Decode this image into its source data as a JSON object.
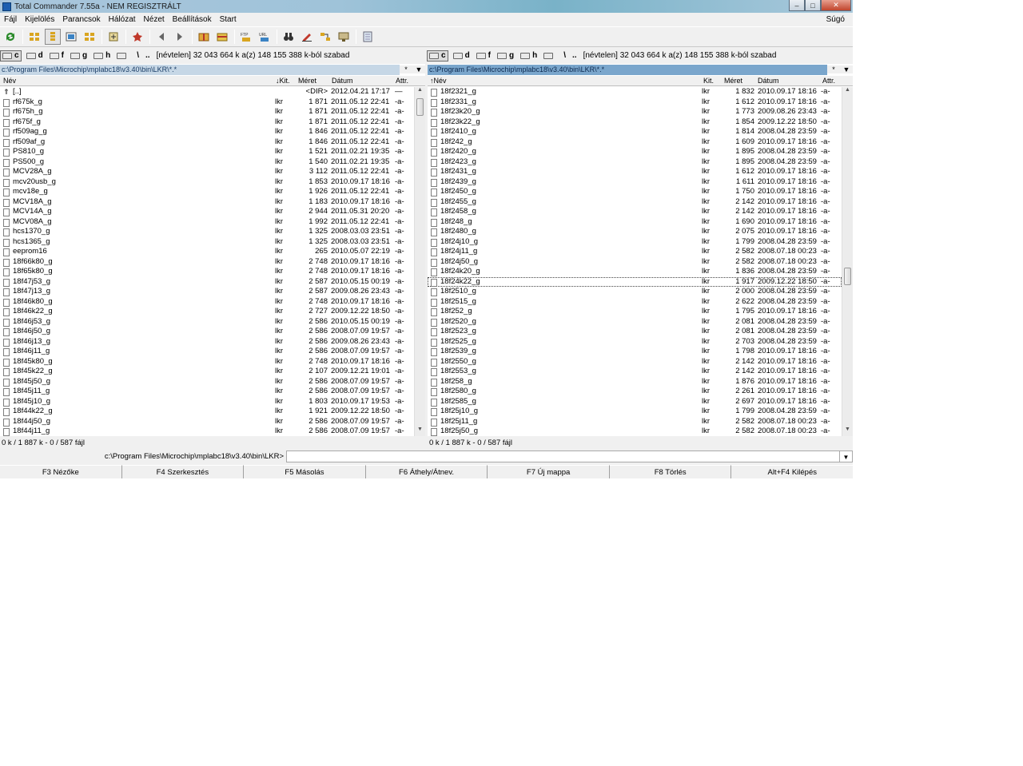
{
  "window": {
    "title": "Total Commander 7.55a - NEM REGISZTRÁLT",
    "min": "–",
    "max": "□",
    "close": "✕"
  },
  "menu": [
    "Fájl",
    "Kijelölés",
    "Parancsok",
    "Hálózat",
    "Nézet",
    "Beállítások",
    "Start"
  ],
  "menu_help": "Súgó",
  "drives": {
    "items": [
      {
        "label": "c",
        "active": true
      },
      {
        "label": "d"
      },
      {
        "label": "f"
      },
      {
        "label": "g"
      },
      {
        "label": "h"
      }
    ],
    "root": "\\",
    "up": "..",
    "info": "[névtelen]  32 043 664 k a(z) 148 155 388 k-ból szabad"
  },
  "left_panel": {
    "path": "c:\\Program Files\\Microchip\\mplabc18\\v3.40\\bin\\LKR\\*.*",
    "star": "*",
    "hist": "▼",
    "columns": {
      "name": "Név",
      "ext": "↓Kit.",
      "size": "Méret",
      "date": "Dátum",
      "attr": "Attr."
    },
    "status": "0 k / 1 887 k - 0 / 587 fájl",
    "rows": [
      {
        "name": "[..]",
        "ext": "",
        "size": "<DIR>",
        "date": "2012.04.21 17:17",
        "attr": "—"
      },
      {
        "name": "rf675k_g",
        "ext": "lkr",
        "size": "1 871",
        "date": "2011.05.12 22:41",
        "attr": "-a-"
      },
      {
        "name": "rf675h_g",
        "ext": "lkr",
        "size": "1 871",
        "date": "2011.05.12 22:41",
        "attr": "-a-"
      },
      {
        "name": "rf675f_g",
        "ext": "lkr",
        "size": "1 871",
        "date": "2011.05.12 22:41",
        "attr": "-a-"
      },
      {
        "name": "rf509ag_g",
        "ext": "lkr",
        "size": "1 846",
        "date": "2011.05.12 22:41",
        "attr": "-a-"
      },
      {
        "name": "rf509af_g",
        "ext": "lkr",
        "size": "1 846",
        "date": "2011.05.12 22:41",
        "attr": "-a-"
      },
      {
        "name": "PS810_g",
        "ext": "lkr",
        "size": "1 521",
        "date": "2011.02.21 19:35",
        "attr": "-a-"
      },
      {
        "name": "PS500_g",
        "ext": "lkr",
        "size": "1 540",
        "date": "2011.02.21 19:35",
        "attr": "-a-"
      },
      {
        "name": "MCV28A_g",
        "ext": "lkr",
        "size": "3 112",
        "date": "2011.05.12 22:41",
        "attr": "-a-"
      },
      {
        "name": "mcv20usb_g",
        "ext": "lkr",
        "size": "1 853",
        "date": "2010.09.17 18:16",
        "attr": "-a-"
      },
      {
        "name": "mcv18e_g",
        "ext": "lkr",
        "size": "1 926",
        "date": "2011.05.12 22:41",
        "attr": "-a-"
      },
      {
        "name": "MCV18A_g",
        "ext": "lkr",
        "size": "1 183",
        "date": "2010.09.17 18:16",
        "attr": "-a-"
      },
      {
        "name": "MCV14A_g",
        "ext": "lkr",
        "size": "2 944",
        "date": "2011.05.31 20:20",
        "attr": "-a-"
      },
      {
        "name": "MCV08A_g",
        "ext": "lkr",
        "size": "1 992",
        "date": "2011.05.12 22:41",
        "attr": "-a-"
      },
      {
        "name": "hcs1370_g",
        "ext": "lkr",
        "size": "1 325",
        "date": "2008.03.03 23:51",
        "attr": "-a-"
      },
      {
        "name": "hcs1365_g",
        "ext": "lkr",
        "size": "1 325",
        "date": "2008.03.03 23:51",
        "attr": "-a-"
      },
      {
        "name": "eeprom16",
        "ext": "lkr",
        "size": "265",
        "date": "2010.05.07 22:19",
        "attr": "-a-"
      },
      {
        "name": "18f66k80_g",
        "ext": "lkr",
        "size": "2 748",
        "date": "2010.09.17 18:16",
        "attr": "-a-"
      },
      {
        "name": "18f65k80_g",
        "ext": "lkr",
        "size": "2 748",
        "date": "2010.09.17 18:16",
        "attr": "-a-"
      },
      {
        "name": "18f47j53_g",
        "ext": "lkr",
        "size": "2 587",
        "date": "2010.05.15 00:19",
        "attr": "-a-"
      },
      {
        "name": "18f47j13_g",
        "ext": "lkr",
        "size": "2 587",
        "date": "2009.08.26 23:43",
        "attr": "-a-"
      },
      {
        "name": "18f46k80_g",
        "ext": "lkr",
        "size": "2 748",
        "date": "2010.09.17 18:16",
        "attr": "-a-"
      },
      {
        "name": "18f46k22_g",
        "ext": "lkr",
        "size": "2 727",
        "date": "2009.12.22 18:50",
        "attr": "-a-"
      },
      {
        "name": "18f46j53_g",
        "ext": "lkr",
        "size": "2 586",
        "date": "2010.05.15 00:19",
        "attr": "-a-"
      },
      {
        "name": "18f46j50_g",
        "ext": "lkr",
        "size": "2 586",
        "date": "2008.07.09 19:57",
        "attr": "-a-"
      },
      {
        "name": "18f46j13_g",
        "ext": "lkr",
        "size": "2 586",
        "date": "2009.08.26 23:43",
        "attr": "-a-"
      },
      {
        "name": "18f46j11_g",
        "ext": "lkr",
        "size": "2 586",
        "date": "2008.07.09 19:57",
        "attr": "-a-"
      },
      {
        "name": "18f45k80_g",
        "ext": "lkr",
        "size": "2 748",
        "date": "2010.09.17 18:16",
        "attr": "-a-"
      },
      {
        "name": "18f45k22_g",
        "ext": "lkr",
        "size": "2 107",
        "date": "2009.12.21 19:01",
        "attr": "-a-"
      },
      {
        "name": "18f45j50_g",
        "ext": "lkr",
        "size": "2 586",
        "date": "2008.07.09 19:57",
        "attr": "-a-"
      },
      {
        "name": "18f45j11_g",
        "ext": "lkr",
        "size": "2 586",
        "date": "2008.07.09 19:57",
        "attr": "-a-"
      },
      {
        "name": "18f45j10_g",
        "ext": "lkr",
        "size": "1 803",
        "date": "2010.09.17 19:53",
        "attr": "-a-"
      },
      {
        "name": "18f44k22_g",
        "ext": "lkr",
        "size": "1 921",
        "date": "2009.12.22 18:50",
        "attr": "-a-"
      },
      {
        "name": "18f44j50_g",
        "ext": "lkr",
        "size": "2 586",
        "date": "2008.07.09 19:57",
        "attr": "-a-"
      },
      {
        "name": "18f44j11_g",
        "ext": "lkr",
        "size": "2 586",
        "date": "2008.07.09 19:57",
        "attr": "-a-"
      }
    ]
  },
  "right_panel": {
    "path": "c:\\Program Files\\Microchip\\mplabc18\\v3.40\\bin\\LKR\\*.*",
    "star": "*",
    "hist": "▼",
    "columns": {
      "name": "↑Név",
      "ext": "Kit.",
      "size": "Méret",
      "date": "Dátum",
      "attr": "Attr."
    },
    "status": "0 k / 1 887 k - 0 / 587 fájl",
    "rows": [
      {
        "name": "18f2321_g",
        "ext": "lkr",
        "size": "1 832",
        "date": "2010.09.17 18:16",
        "attr": "-a-"
      },
      {
        "name": "18f2331_g",
        "ext": "lkr",
        "size": "1 612",
        "date": "2010.09.17 18:16",
        "attr": "-a-"
      },
      {
        "name": "18f23k20_g",
        "ext": "lkr",
        "size": "1 773",
        "date": "2009.08.26 23:43",
        "attr": "-a-"
      },
      {
        "name": "18f23k22_g",
        "ext": "lkr",
        "size": "1 854",
        "date": "2009.12.22 18:50",
        "attr": "-a-"
      },
      {
        "name": "18f2410_g",
        "ext": "lkr",
        "size": "1 814",
        "date": "2008.04.28 23:59",
        "attr": "-a-"
      },
      {
        "name": "18f242_g",
        "ext": "lkr",
        "size": "1 609",
        "date": "2010.09.17 18:16",
        "attr": "-a-"
      },
      {
        "name": "18f2420_g",
        "ext": "lkr",
        "size": "1 895",
        "date": "2008.04.28 23:59",
        "attr": "-a-"
      },
      {
        "name": "18f2423_g",
        "ext": "lkr",
        "size": "1 895",
        "date": "2008.04.28 23:59",
        "attr": "-a-"
      },
      {
        "name": "18f2431_g",
        "ext": "lkr",
        "size": "1 612",
        "date": "2010.09.17 18:16",
        "attr": "-a-"
      },
      {
        "name": "18f2439_g",
        "ext": "lkr",
        "size": "1 611",
        "date": "2010.09.17 18:16",
        "attr": "-a-"
      },
      {
        "name": "18f2450_g",
        "ext": "lkr",
        "size": "1 750",
        "date": "2010.09.17 18:16",
        "attr": "-a-"
      },
      {
        "name": "18f2455_g",
        "ext": "lkr",
        "size": "2 142",
        "date": "2010.09.17 18:16",
        "attr": "-a-"
      },
      {
        "name": "18f2458_g",
        "ext": "lkr",
        "size": "2 142",
        "date": "2010.09.17 18:16",
        "attr": "-a-"
      },
      {
        "name": "18f248_g",
        "ext": "lkr",
        "size": "1 690",
        "date": "2010.09.17 18:16",
        "attr": "-a-"
      },
      {
        "name": "18f2480_g",
        "ext": "lkr",
        "size": "2 075",
        "date": "2010.09.17 18:16",
        "attr": "-a-"
      },
      {
        "name": "18f24j10_g",
        "ext": "lkr",
        "size": "1 799",
        "date": "2008.04.28 23:59",
        "attr": "-a-"
      },
      {
        "name": "18f24j11_g",
        "ext": "lkr",
        "size": "2 582",
        "date": "2008.07.18 00:23",
        "attr": "-a-"
      },
      {
        "name": "18f24j50_g",
        "ext": "lkr",
        "size": "2 582",
        "date": "2008.07.18 00:23",
        "attr": "-a-"
      },
      {
        "name": "18f24k20_g",
        "ext": "lkr",
        "size": "1 836",
        "date": "2008.04.28 23:59",
        "attr": "-a-"
      },
      {
        "name": "18f24k22_g",
        "ext": "lkr",
        "size": "1 917",
        "date": "2009.12.22 18:50",
        "attr": "-a-",
        "cursor": true
      },
      {
        "name": "18f2510_g",
        "ext": "lkr",
        "size": "2 000",
        "date": "2008.04.28 23:59",
        "attr": "-a-"
      },
      {
        "name": "18f2515_g",
        "ext": "lkr",
        "size": "2 622",
        "date": "2008.04.28 23:59",
        "attr": "-a-"
      },
      {
        "name": "18f252_g",
        "ext": "lkr",
        "size": "1 795",
        "date": "2010.09.17 18:16",
        "attr": "-a-"
      },
      {
        "name": "18f2520_g",
        "ext": "lkr",
        "size": "2 081",
        "date": "2008.04.28 23:59",
        "attr": "-a-"
      },
      {
        "name": "18f2523_g",
        "ext": "lkr",
        "size": "2 081",
        "date": "2008.04.28 23:59",
        "attr": "-a-"
      },
      {
        "name": "18f2525_g",
        "ext": "lkr",
        "size": "2 703",
        "date": "2008.04.28 23:59",
        "attr": "-a-"
      },
      {
        "name": "18f2539_g",
        "ext": "lkr",
        "size": "1 798",
        "date": "2010.09.17 18:16",
        "attr": "-a-"
      },
      {
        "name": "18f2550_g",
        "ext": "lkr",
        "size": "2 142",
        "date": "2010.09.17 18:16",
        "attr": "-a-"
      },
      {
        "name": "18f2553_g",
        "ext": "lkr",
        "size": "2 142",
        "date": "2010.09.17 18:16",
        "attr": "-a-"
      },
      {
        "name": "18f258_g",
        "ext": "lkr",
        "size": "1 876",
        "date": "2010.09.17 18:16",
        "attr": "-a-"
      },
      {
        "name": "18f2580_g",
        "ext": "lkr",
        "size": "2 261",
        "date": "2010.09.17 18:16",
        "attr": "-a-"
      },
      {
        "name": "18f2585_g",
        "ext": "lkr",
        "size": "2 697",
        "date": "2010.09.17 18:16",
        "attr": "-a-"
      },
      {
        "name": "18f25j10_g",
        "ext": "lkr",
        "size": "1 799",
        "date": "2008.04.28 23:59",
        "attr": "-a-"
      },
      {
        "name": "18f25j11_g",
        "ext": "lkr",
        "size": "2 582",
        "date": "2008.07.18 00:23",
        "attr": "-a-"
      },
      {
        "name": "18f25j50_g",
        "ext": "lkr",
        "size": "2 582",
        "date": "2008.07.18 00:23",
        "attr": "-a-"
      }
    ]
  },
  "command": {
    "prompt": "c:\\Program Files\\Microchip\\mplabc18\\v3.40\\bin\\LKR>",
    "value": ""
  },
  "fkeys": [
    "F3 Nézőke",
    "F4 Szerkesztés",
    "F5 Másolás",
    "F6 Áthely/Átnev.",
    "F7 Új mappa",
    "F8 Törlés",
    "Alt+F4 Kilépés"
  ]
}
